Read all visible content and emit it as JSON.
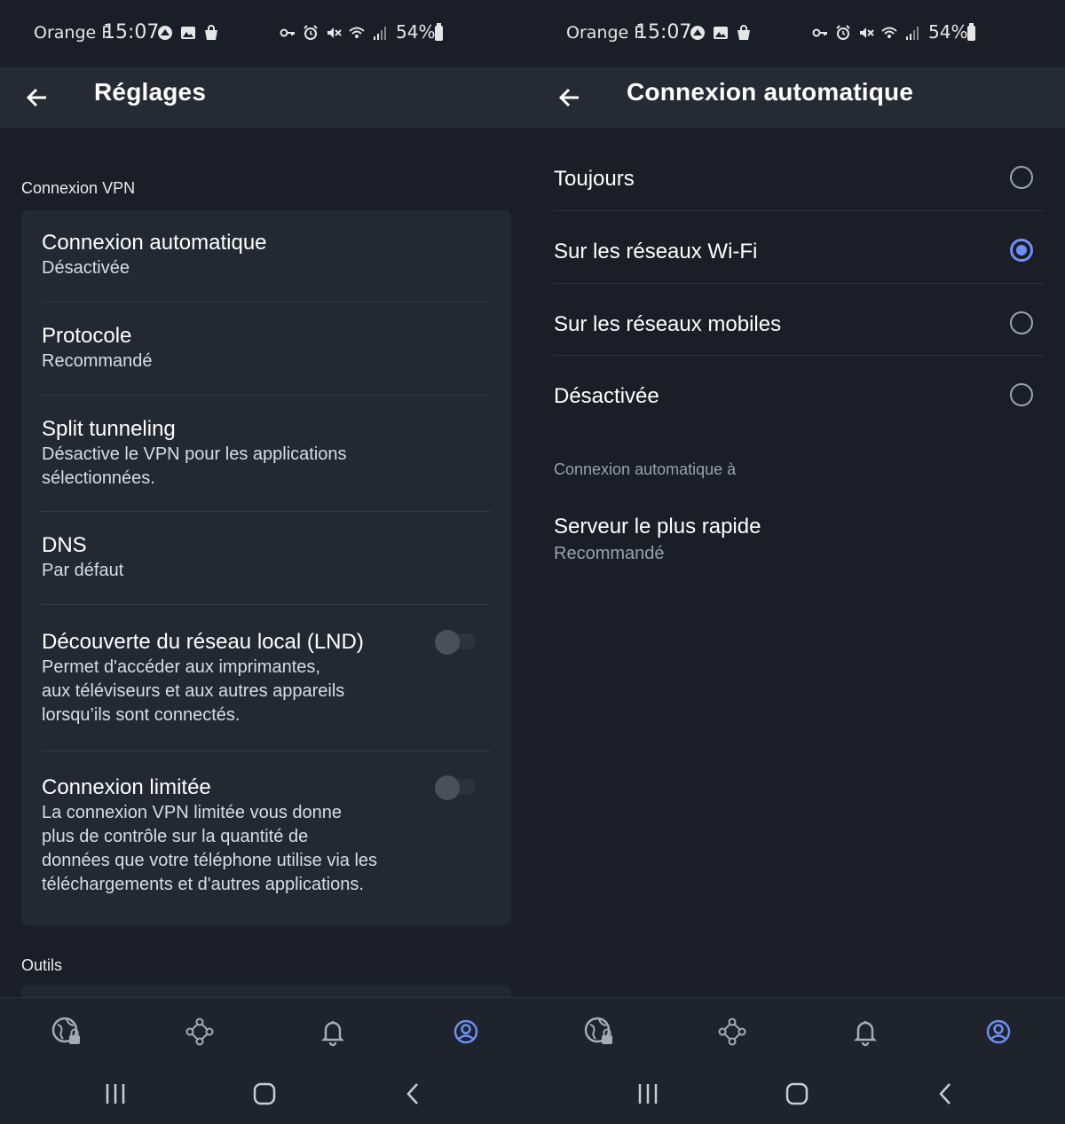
{
  "status_bar": {
    "carrier": "Orange F",
    "time": "15:07",
    "battery": "54%"
  },
  "left_screen": {
    "header": {
      "title": "Réglages"
    },
    "section_vpn": "Connexion VPN",
    "settings": [
      {
        "title": "Connexion automatique",
        "subtitle": "Désactivée"
      },
      {
        "title": "Protocole",
        "subtitle": "Recommandé"
      },
      {
        "title": "Split tunneling",
        "subtitle_lines": [
          "Désactive le VPN pour les applications",
          "sélectionnées."
        ]
      },
      {
        "title": "DNS",
        "subtitle": "Par défaut"
      },
      {
        "title": "Découverte du réseau local (LND)",
        "subtitle_lines": [
          "Permet d'accéder aux imprimantes,",
          "aux téléviseurs et aux autres appareils",
          "lorsqu’ils sont connectés."
        ],
        "toggle": false
      },
      {
        "title": "Connexion limitée",
        "subtitle_lines": [
          "La connexion VPN limitée vous donne",
          "plus de contrôle sur la quantité de",
          "données que votre téléphone utilise via les",
          "téléchargements et d'autres applications."
        ],
        "toggle": false
      }
    ],
    "section_tools": "Outils"
  },
  "right_screen": {
    "header": {
      "title": "Connexion automatique"
    },
    "options": [
      {
        "label": "Toujours",
        "selected": false
      },
      {
        "label": "Sur les réseaux Wi-Fi",
        "selected": true
      },
      {
        "label": "Sur les réseaux mobiles",
        "selected": false
      },
      {
        "label": "Désactivée",
        "selected": false
      }
    ],
    "connect_to_label": "Connexion automatique à",
    "server": {
      "title": "Serveur le plus rapide",
      "subtitle": "Recommandé"
    }
  },
  "bottom_nav": {
    "items": [
      "globe-lock-icon",
      "network-nodes-icon",
      "bell-icon",
      "account-icon"
    ],
    "active_index": 3
  },
  "colors": {
    "background": "#1b1e26",
    "header": "#252a35",
    "card": "#242833",
    "accent": "#6e8ff4"
  }
}
